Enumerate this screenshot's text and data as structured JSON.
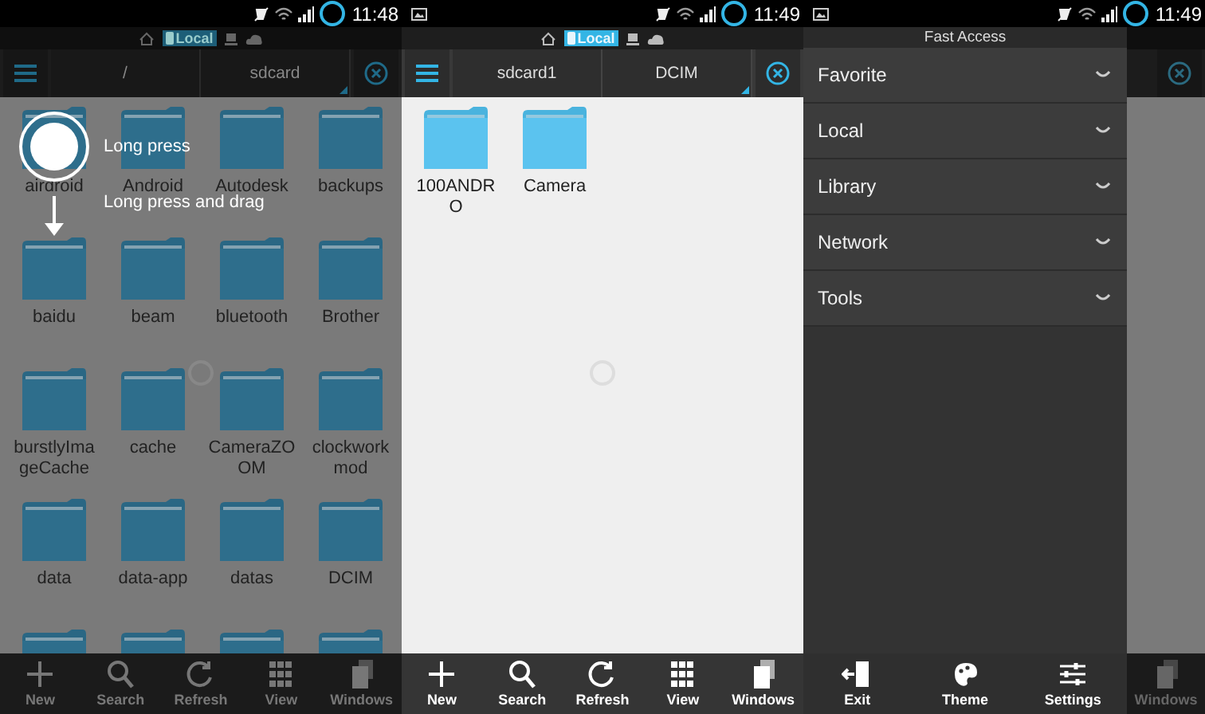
{
  "screens": [
    {
      "time": "11:48",
      "notification_icon": false,
      "dimmed": true,
      "loading": true,
      "location_tabs": [
        {
          "kind": "home",
          "selected": false
        },
        {
          "kind": "local",
          "label": "Local",
          "selected": true
        },
        {
          "kind": "computer",
          "selected": false
        },
        {
          "kind": "cloud",
          "selected": false
        }
      ],
      "path": [
        "/",
        "sdcard"
      ],
      "folders": [
        {
          "kind": "folder",
          "name": "airdroid"
        },
        {
          "kind": "folder",
          "name": "Android"
        },
        {
          "kind": "folder",
          "name": "Autodesk"
        },
        {
          "kind": "folder",
          "name": "backups"
        },
        {
          "kind": "folder",
          "name": "baidu"
        },
        {
          "kind": "folder",
          "name": "beam"
        },
        {
          "kind": "folder",
          "name": "bluetooth"
        },
        {
          "kind": "folder",
          "name": "Brother"
        },
        {
          "kind": "folder",
          "name": "burstlyImageCache"
        },
        {
          "kind": "folder",
          "name": "cache"
        },
        {
          "kind": "folder",
          "name": "CameraZOOM"
        },
        {
          "kind": "folder",
          "name": "clockworkmod"
        },
        {
          "kind": "folder",
          "name": "data"
        },
        {
          "kind": "folder",
          "name": "data-app"
        },
        {
          "kind": "folder",
          "name": "datas"
        },
        {
          "kind": "folder",
          "name": "DCIM"
        },
        {
          "kind": "cut_off"
        },
        {
          "kind": "cut_off"
        },
        {
          "kind": "cut_off"
        },
        {
          "kind": "cut_off"
        }
      ],
      "hints": [
        "Long press",
        "Long press and drag"
      ],
      "toolbar": [
        {
          "kind": "new",
          "label": "New"
        },
        {
          "kind": "search",
          "label": "Search"
        },
        {
          "kind": "refresh",
          "label": "Refresh"
        },
        {
          "kind": "view",
          "label": "View"
        },
        {
          "kind": "windows",
          "label": "Windows"
        }
      ]
    },
    {
      "time": "11:49",
      "notification_icon": true,
      "dimmed": false,
      "loading": true,
      "location_tabs": [
        {
          "kind": "home",
          "selected": false
        },
        {
          "kind": "local",
          "label": "Local",
          "selected": true
        },
        {
          "kind": "computer",
          "selected": false
        },
        {
          "kind": "cloud",
          "selected": false
        }
      ],
      "path": [
        "sdcard1",
        "DCIM"
      ],
      "folders": [
        {
          "kind": "folder",
          "name": "100ANDRO"
        },
        {
          "kind": "folder",
          "name": "Camera"
        }
      ],
      "toolbar": [
        {
          "kind": "new",
          "label": "New"
        },
        {
          "kind": "search",
          "label": "Search"
        },
        {
          "kind": "refresh",
          "label": "Refresh"
        },
        {
          "kind": "view",
          "label": "View"
        },
        {
          "kind": "windows",
          "label": "Windows"
        }
      ]
    },
    {
      "time": "11:49",
      "notification_icon": true,
      "drawer": {
        "title": "Fast Access",
        "items": [
          {
            "label": "Favorite",
            "expanded": false
          },
          {
            "label": "Local",
            "expanded": false
          },
          {
            "label": "Library",
            "expanded": false
          },
          {
            "label": "Network",
            "expanded": false
          },
          {
            "label": "Tools",
            "expanded": false
          }
        ],
        "actions": [
          {
            "kind": "exit",
            "label": "Exit"
          },
          {
            "kind": "theme",
            "label": "Theme"
          },
          {
            "kind": "settings",
            "label": "Settings"
          }
        ]
      },
      "behind_toolbar": [
        {
          "kind": "windows",
          "label": "Windows"
        }
      ]
    }
  ]
}
